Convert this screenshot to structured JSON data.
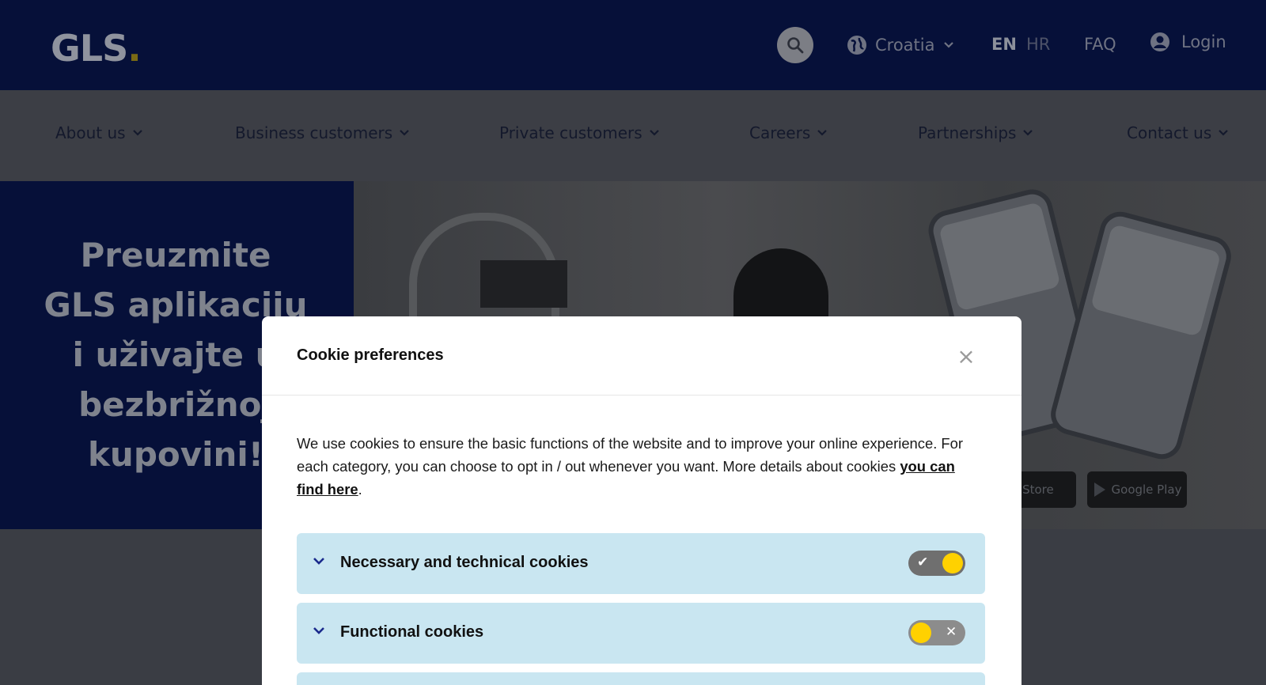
{
  "header": {
    "logo_text": "GLS",
    "logo_dot": ".",
    "country": "Croatia",
    "lang_en": "EN",
    "lang_hr": "HR",
    "faq": "FAQ",
    "login": "Login"
  },
  "nav": {
    "items": [
      {
        "label": "About us"
      },
      {
        "label": "Business customers"
      },
      {
        "label": "Private customers"
      },
      {
        "label": "Careers"
      },
      {
        "label": "Partnerships"
      },
      {
        "label": "Contact us"
      }
    ]
  },
  "hero": {
    "title_lines": [
      "Preuzmite",
      "GLS aplikaciju",
      "i uživajte u",
      "bezbrižnoj",
      "kupovini!"
    ],
    "store_app": "pp Store",
    "store_play": "Google Play"
  },
  "modal": {
    "title": "Cookie preferences",
    "close": "×",
    "text_before_link": "We use cookies to ensure the basic functions of the website and to improve your online experience. For each category, you can choose to opt in / out whenever you want. More details about cookies ",
    "link": "you can find here",
    "text_after_link": ".",
    "categories": [
      {
        "label": "Necessary and technical cookies",
        "toggle_mark": "✔"
      },
      {
        "label": "Functional cookies",
        "toggle_mark": "✕"
      }
    ]
  },
  "colors": {
    "brand_navy": "#061039",
    "brand_yellow": "#ffd100",
    "category_bg": "#c9e6f1"
  }
}
